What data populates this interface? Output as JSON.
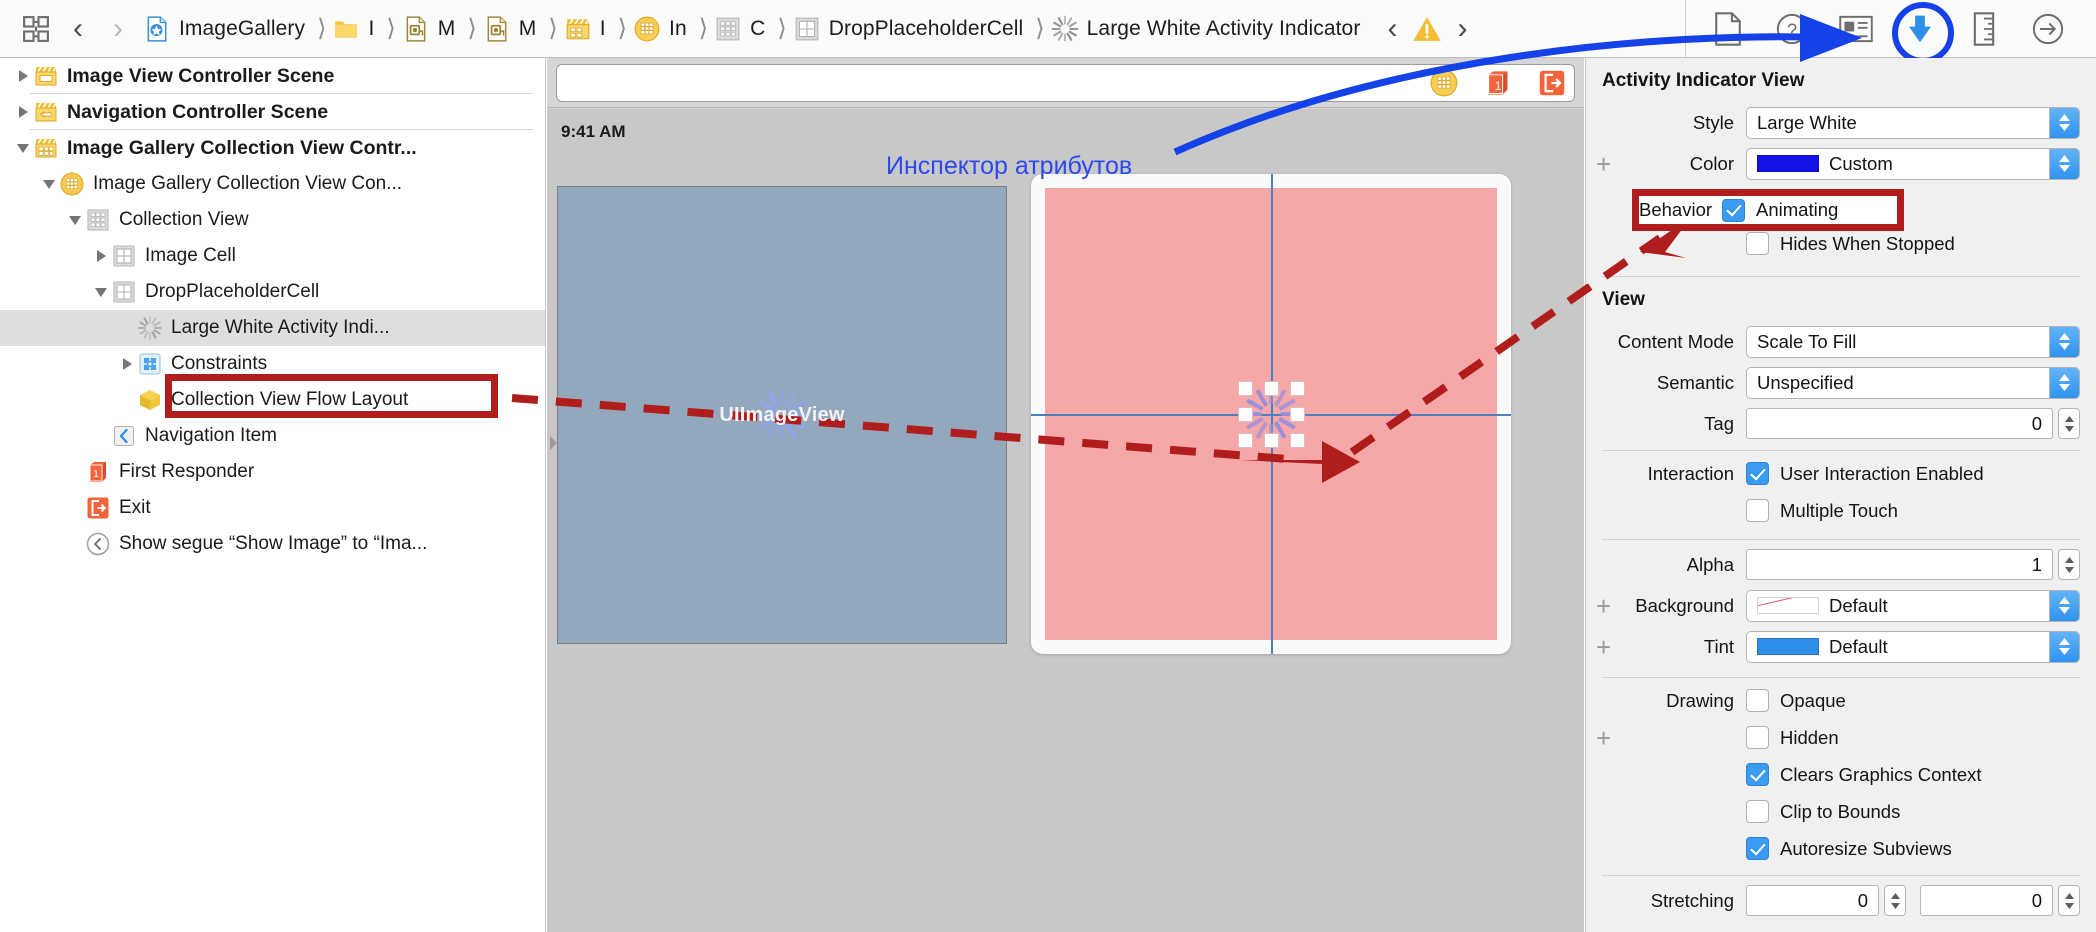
{
  "toolbar": {
    "grid_icon": "grid-toggle-icon",
    "back_label": "‹",
    "forward_label": "›",
    "breadcrumbs": [
      {
        "label": "ImageGallery",
        "icon": "xcode-project-icon"
      },
      {
        "label": "I",
        "icon": "folder-icon"
      },
      {
        "label": "M",
        "icon": "storyboard-file-icon"
      },
      {
        "label": "M",
        "icon": "storyboard-file-icon"
      },
      {
        "label": "I",
        "icon": "scene-icon"
      },
      {
        "label": "In",
        "icon": "view-controller-icon"
      },
      {
        "label": "C",
        "icon": "collection-view-icon"
      },
      {
        "label": "DropPlaceholderCell",
        "icon": "cell-icon"
      },
      {
        "label": "Large White Activity Indicator",
        "icon": "activity-indicator-icon"
      }
    ],
    "issue_prev": "‹",
    "issue_next": "›",
    "warning_icon": "warning-triangle-icon",
    "inspector_tabs": [
      {
        "name": "file-inspector-icon",
        "selected": false
      },
      {
        "name": "quick-help-inspector-icon",
        "selected": false
      },
      {
        "name": "identity-inspector-icon",
        "selected": false
      },
      {
        "name": "attributes-inspector-icon",
        "selected": true
      },
      {
        "name": "size-inspector-icon",
        "selected": false
      },
      {
        "name": "connections-inspector-icon",
        "selected": false
      }
    ]
  },
  "outline": {
    "rows": [
      {
        "label": "Image View Controller Scene",
        "icon": "scene-icon",
        "disclosure": "collapsed",
        "indent": 0,
        "bold": true,
        "separator": true
      },
      {
        "label": "Navigation Controller Scene",
        "icon": "nav-scene-icon",
        "disclosure": "collapsed",
        "indent": 0,
        "bold": true,
        "separator": true
      },
      {
        "label": "Image Gallery Collection View Contr...",
        "icon": "collection-scene-icon",
        "disclosure": "expanded",
        "indent": 0,
        "bold": true,
        "separator": false
      },
      {
        "label": "Image Gallery Collection View Con...",
        "icon": "view-controller-icon",
        "disclosure": "expanded",
        "indent": 1,
        "bold": false,
        "separator": false
      },
      {
        "label": "Collection View",
        "icon": "collection-view-icon",
        "disclosure": "expanded",
        "indent": 2,
        "bold": false,
        "separator": false
      },
      {
        "label": "Image Cell",
        "icon": "cell-icon",
        "disclosure": "collapsed",
        "indent": 3,
        "bold": false,
        "separator": false
      },
      {
        "label": "DropPlaceholderCell",
        "icon": "cell-icon",
        "disclosure": "expanded",
        "indent": 3,
        "bold": false,
        "separator": false
      },
      {
        "label": "Large White Activity Indi...",
        "icon": "activity-indicator-icon",
        "disclosure": "none",
        "indent": 4,
        "bold": false,
        "separator": false,
        "selected": true,
        "highlighted": true
      },
      {
        "label": "Constraints",
        "icon": "constraints-icon",
        "disclosure": "collapsed",
        "indent": 4,
        "bold": false,
        "separator": false
      },
      {
        "label": "Collection View Flow Layout",
        "icon": "flow-layout-icon",
        "disclosure": "none",
        "indent": 4,
        "bold": false,
        "separator": false
      },
      {
        "label": "Navigation Item",
        "icon": "navigation-item-icon",
        "disclosure": "none",
        "indent": 3,
        "bold": false,
        "separator": false
      },
      {
        "label": "First Responder",
        "icon": "first-responder-icon",
        "disclosure": "none",
        "indent": 2,
        "bold": false,
        "separator": false
      },
      {
        "label": "Exit",
        "icon": "exit-icon",
        "disclosure": "none",
        "indent": 2,
        "bold": false,
        "separator": false
      },
      {
        "label": "Show segue “Show Image” to “Ima...",
        "icon": "segue-icon",
        "disclosure": "none",
        "indent": 2,
        "bold": false,
        "separator": false
      }
    ]
  },
  "canvas": {
    "dock_icons": [
      {
        "name": "view-controller-dock-icon"
      },
      {
        "name": "first-responder-dock-icon"
      },
      {
        "name": "exit-dock-icon"
      }
    ],
    "status_time": "9:41 AM",
    "image_view_label": "UIImageView",
    "image_view_color": "#94a8bd",
    "placeholder_cell_color": "#f6a7a7",
    "guide_color": "#4a7fc1"
  },
  "inspector": {
    "section_activity": {
      "title": "Activity Indicator View",
      "style_label": "Style",
      "style_value": "Large White",
      "color_label": "Color",
      "color_value": "Custom",
      "color_swatch": "#1414e8",
      "behavior_label": "Behavior",
      "behavior_animating": {
        "label": "Animating",
        "checked": true
      },
      "behavior_hides": {
        "label": "Hides When Stopped",
        "checked": false
      }
    },
    "section_view": {
      "title": "View",
      "content_mode_label": "Content Mode",
      "content_mode_value": "Scale To Fill",
      "semantic_label": "Semantic",
      "semantic_value": "Unspecified",
      "tag_label": "Tag",
      "tag_value": "0",
      "interaction_label": "Interaction",
      "user_interaction": {
        "label": "User Interaction Enabled",
        "checked": true
      },
      "multiple_touch": {
        "label": "Multiple Touch",
        "checked": false
      },
      "alpha_label": "Alpha",
      "alpha_value": "1",
      "background_label": "Background",
      "background_value": "Default",
      "tint_label": "Tint",
      "tint_value": "Default",
      "tint_swatch": "#2f8fe8",
      "drawing_label": "Drawing",
      "opaque": {
        "label": "Opaque",
        "checked": false
      },
      "hidden": {
        "label": "Hidden",
        "checked": false
      },
      "clears_graphics": {
        "label": "Clears Graphics Context",
        "checked": true
      },
      "clip_bounds": {
        "label": "Clip to Bounds",
        "checked": false
      },
      "autoresize": {
        "label": "Autoresize Subviews",
        "checked": true
      },
      "stretching_label": "Stretching",
      "stretching_x": "0",
      "stretching_y": "0"
    }
  },
  "annotations": {
    "inspector_caption": "Инспектор атрибутов",
    "caption_color": "#2a49ef",
    "arrow_color": "#b01d1d",
    "highlight_color": "#b01d1d"
  }
}
